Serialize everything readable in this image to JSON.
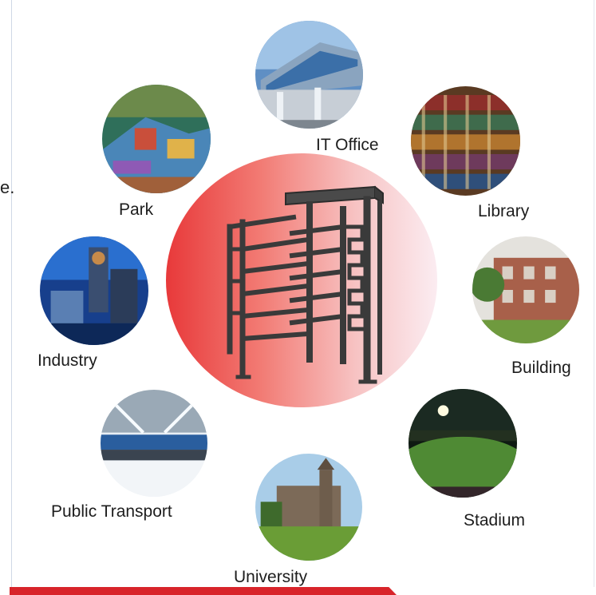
{
  "stray_text": "e.",
  "center": {
    "image": "full-height-turnstile"
  },
  "nodes": [
    {
      "id": "it-office",
      "label": "IT Office",
      "icon": "office-building-photo"
    },
    {
      "id": "library",
      "label": "Library",
      "icon": "bookshelf-photo"
    },
    {
      "id": "park",
      "label": "Park",
      "icon": "playground-photo"
    },
    {
      "id": "industry",
      "label": "Industry",
      "icon": "factory-photo"
    },
    {
      "id": "building",
      "label": "Building",
      "icon": "apartment-photo"
    },
    {
      "id": "public-transport",
      "label": "Public Transport",
      "icon": "station-hall-photo"
    },
    {
      "id": "stadium",
      "label": "Stadium",
      "icon": "stadium-field-photo"
    },
    {
      "id": "university",
      "label": "University",
      "icon": "university-campus-photo"
    }
  ],
  "colors": {
    "accent_red": "#d8242a",
    "disc_start": "#e8393a",
    "disc_end": "#fbecf1"
  }
}
